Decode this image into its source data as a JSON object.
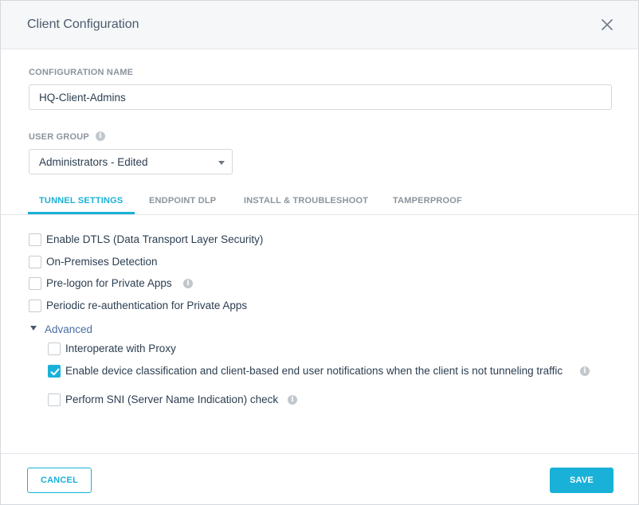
{
  "dialog": {
    "title": "Client Configuration",
    "close_icon": "close-icon"
  },
  "config_name": {
    "label": "CONFIGURATION NAME",
    "value": "HQ-Client-Admins"
  },
  "user_group": {
    "label": "USER GROUP",
    "info_icon": "info-icon",
    "selected": "Administrators - Edited"
  },
  "tabs": [
    {
      "label": "TUNNEL SETTINGS",
      "active": true
    },
    {
      "label": "ENDPOINT DLP",
      "active": false
    },
    {
      "label": "INSTALL & TROUBLESHOOT",
      "active": false
    },
    {
      "label": "TAMPERPROOF",
      "active": false
    }
  ],
  "options": [
    {
      "label": "Enable DTLS (Data Transport Layer Security)",
      "checked": false
    },
    {
      "label": "On-Premises Detection",
      "checked": false
    },
    {
      "label": "Pre-logon for Private Apps",
      "checked": false,
      "info": true
    },
    {
      "label": "Periodic re-authentication for Private Apps",
      "checked": false
    }
  ],
  "advanced": {
    "label": "Advanced",
    "expanded": true,
    "options": [
      {
        "label": "Interoperate with Proxy",
        "checked": false
      },
      {
        "label": "Enable device classification and client-based end user notifications when the client is not tunneling traffic",
        "checked": true,
        "info": true
      },
      {
        "label": "Perform SNI (Server Name Indication) check",
        "checked": false,
        "info": true
      }
    ]
  },
  "footer": {
    "cancel_label": "CANCEL",
    "save_label": "SAVE"
  },
  "colors": {
    "accent": "#1ab1d8",
    "header_bg": "#f6f7f8",
    "text": "#2c3e50",
    "muted": "#8b949e"
  }
}
